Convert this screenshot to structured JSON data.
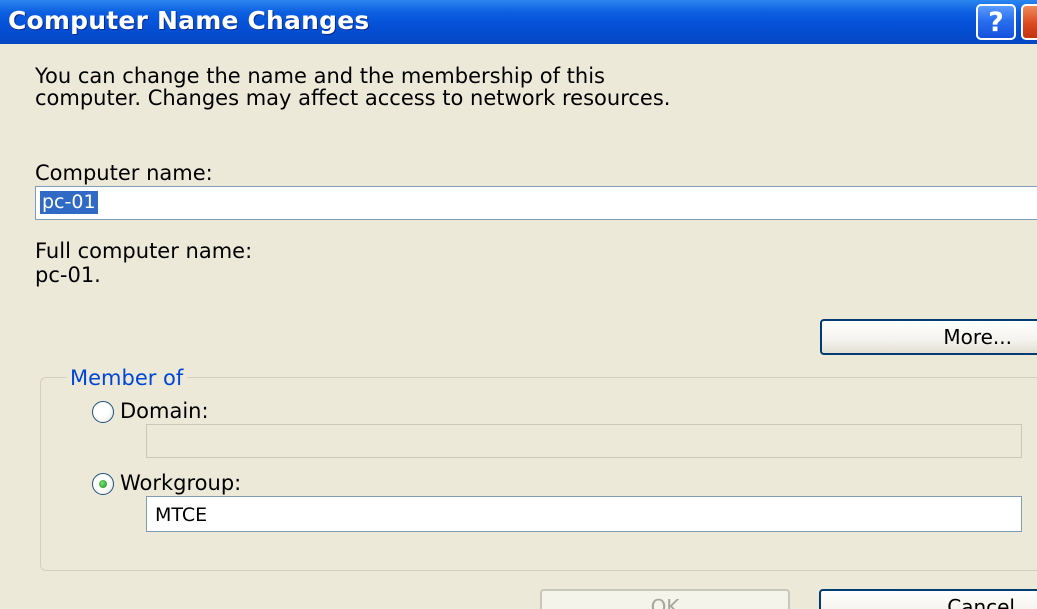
{
  "window": {
    "title": "Computer Name Changes",
    "help_glyph": "?"
  },
  "dialog": {
    "description_line1": "You can change the name and the membership of this",
    "description_line2": "computer. Changes may affect access to network resources.",
    "computer_name_label": "Computer name:",
    "computer_name_value": "pc-01",
    "full_name_label": "Full computer name:",
    "full_name_value": "pc-01.",
    "more_button": "More..."
  },
  "member_of": {
    "legend": "Member of",
    "domain_label": "Domain:",
    "domain_value": "",
    "domain_selected": false,
    "workgroup_label": "Workgroup:",
    "workgroup_value": "MTCE",
    "workgroup_selected": true
  },
  "footer": {
    "ok_button": "OK",
    "cancel_button": "Cancel",
    "ok_enabled": false
  },
  "colors": {
    "titlebar": "#0551d8",
    "face": "#ece9d8",
    "group_legend": "#0046d5",
    "selection": "#316ac5",
    "button_border": "#003c74"
  },
  "icons": {
    "help": "help-icon",
    "radio_checked": "radio-checked-icon",
    "radio_unchecked": "radio-unchecked-icon"
  }
}
